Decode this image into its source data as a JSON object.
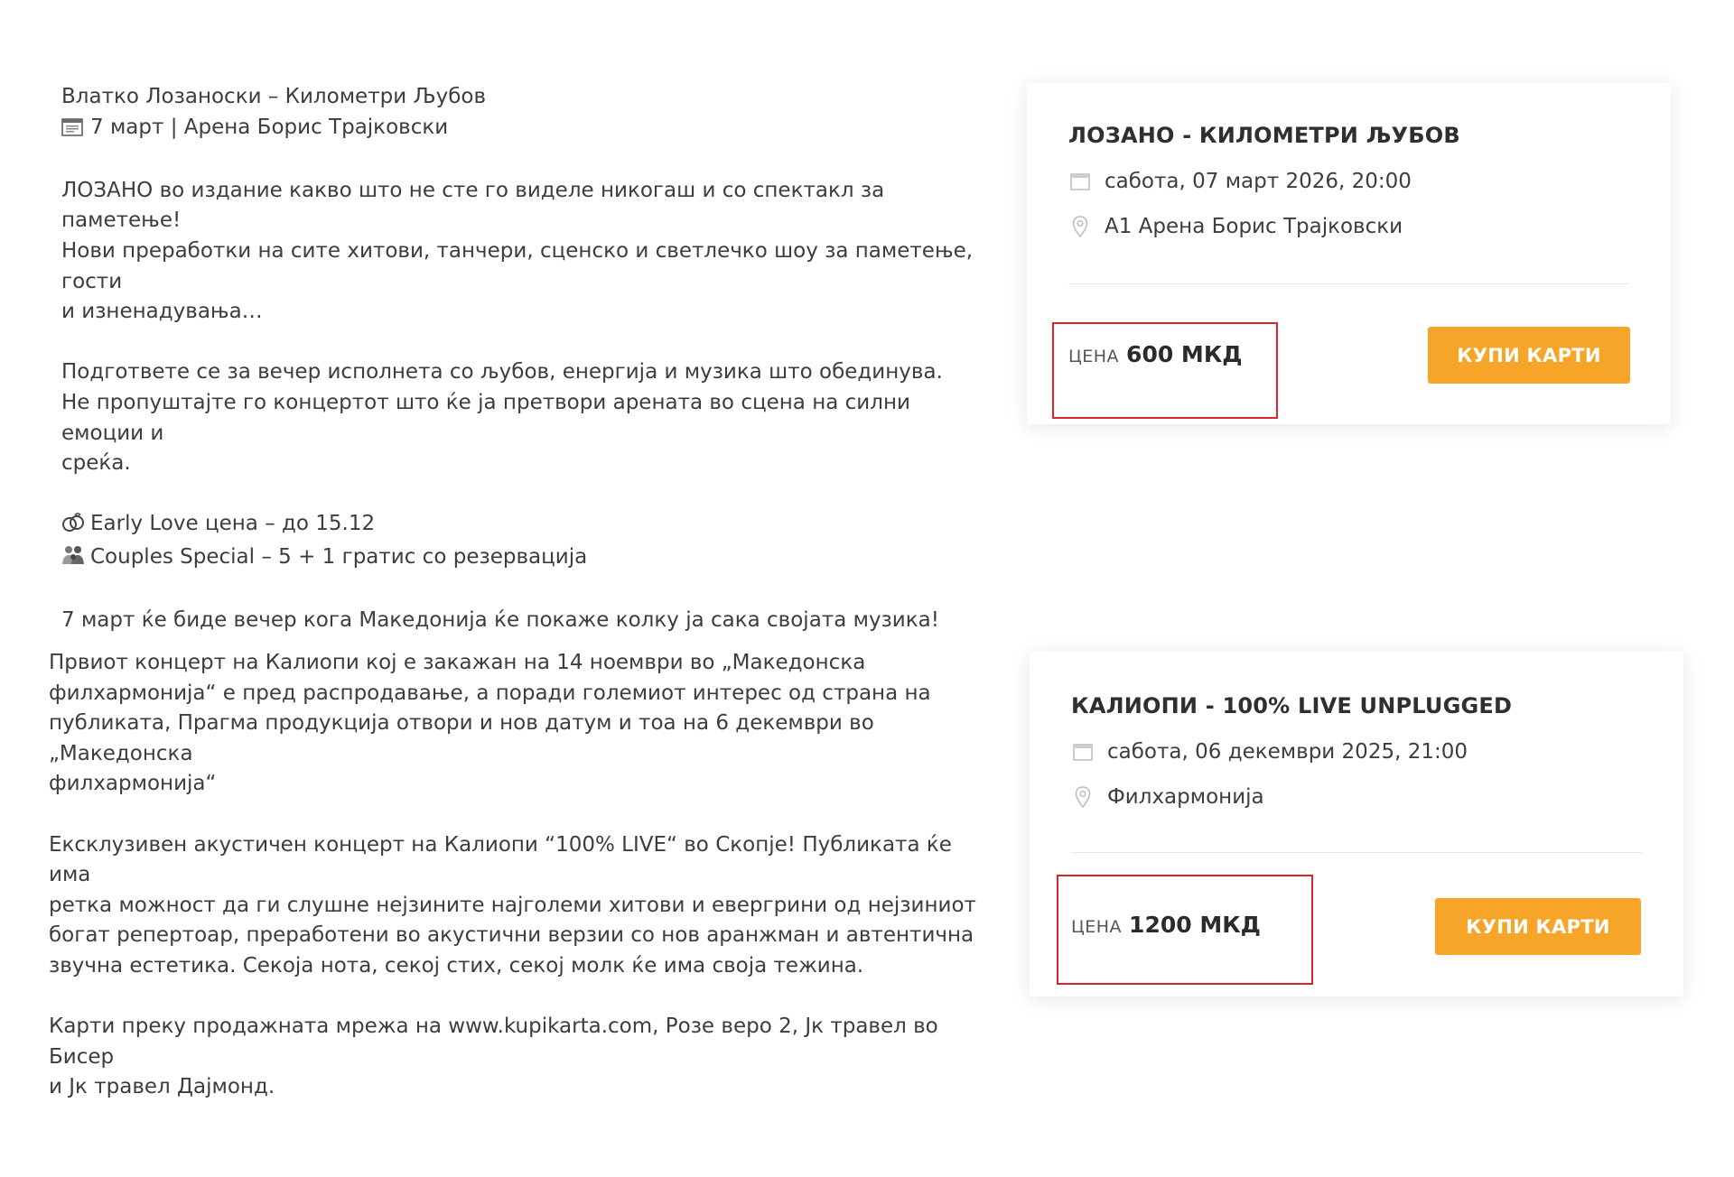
{
  "events": [
    {
      "description": {
        "headline": "Влатко Лозаноски – Километри Љубов",
        "date_venue": "7 март | Арена Борис Трајковски",
        "paragraph1": [
          "ЛОЗАНО во издание какво што не сте го виделе никогаш и со спектакл за паметење!",
          "Нови преработки на сите хитови, танчери, сценско и светлечко шоу за паметење, гости",
          "и изненадувања…"
        ],
        "paragraph2": [
          "Подгответе се за вечер исполнета со љубов, енергија и музика што обединува.",
          "Не пропуштајте го концертот што ќе ја претвори арената во сцена на силни емоции и",
          "среќа."
        ],
        "offers": [
          {
            "icon": "rings-icon",
            "text": "Early Love цена – до 15.12"
          },
          {
            "icon": "couple-icon",
            "text": "Couples Special – 5 + 1 гратис со резервација"
          }
        ],
        "closing": "7 март ќе биде вечер кога Македонија ќе покаже колку ја сака својата музика!"
      },
      "card": {
        "title": "ЛОЗАНО - КИЛОМЕТРИ ЉУБОВ",
        "datetime": "сабота, 07 март 2026, 20:00",
        "venue": "А1 Арена Борис Трајковски",
        "price_label": "ЦЕНА",
        "price_value": "600 МКД",
        "buy_label": "КУПИ КАРТИ"
      }
    },
    {
      "description": {
        "paragraph1": [
          "Првиот концерт на Калиопи кој е закажан на 14 ноември во „Македонска",
          "филхармонија“ е пред распродавање, а поради големиот интерес од страна на",
          "публиката, Прагма продукција отвори и нов датум и тоа на 6 декември во „Македонска",
          "филхармонија“"
        ],
        "paragraph2": [
          "Ексклузивен акустичен концерт на Калиопи “100% LIVE“ во Скопје! Публиката ќе има",
          "ретка можност да ги слушне нејзините најголеми хитови и евергрини од нејзиниот",
          "богат репертоар, преработени во акустични верзии со нов аранжман и автентична",
          "звучна естетика. Секоја нота, секој стих, секој молк ќе има своја тежина."
        ],
        "paragraph3": [
          "Карти преку продажната мрежа на www.kupikarta.com, Розе веро 2, Јк травел во Бисер",
          "и Јк травел Дајмонд."
        ]
      },
      "card": {
        "title": "КАЛИОПИ - 100% LIVE UNPLUGGED",
        "datetime": "сабота, 06 декември 2025, 21:00",
        "venue": "Филхармонија",
        "price_label": "ЦЕНА",
        "price_value": "1200 МКД",
        "buy_label": "КУПИ КАРТИ"
      }
    }
  ],
  "colors": {
    "accent": "#f7a529",
    "highlight": "#d9252b",
    "text": "#3d3d3d"
  }
}
